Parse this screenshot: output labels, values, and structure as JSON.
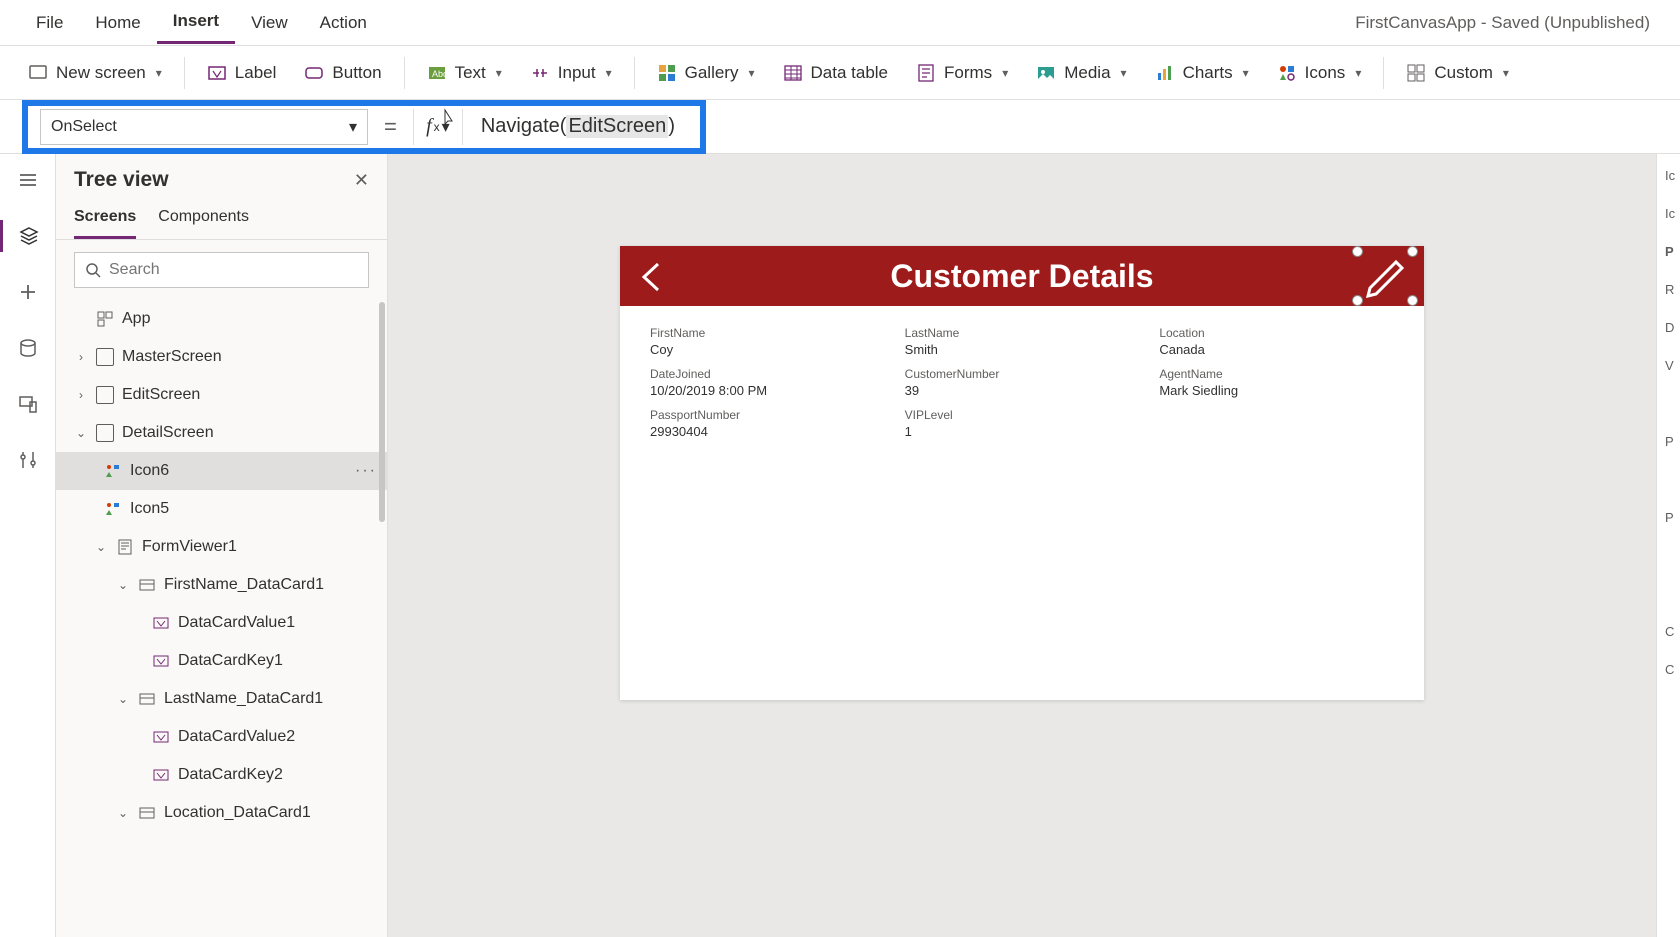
{
  "app_title": "FirstCanvasApp - Saved (Unpublished)",
  "menu": {
    "file": "File",
    "home": "Home",
    "insert": "Insert",
    "view": "View",
    "action": "Action"
  },
  "ribbon": {
    "new_screen": "New screen",
    "label": "Label",
    "button": "Button",
    "text": "Text",
    "input": "Input",
    "gallery": "Gallery",
    "data_table": "Data table",
    "forms": "Forms",
    "media": "Media",
    "charts": "Charts",
    "icons": "Icons",
    "custom": "Custom"
  },
  "formula": {
    "property": "OnSelect",
    "fn": "Navigate",
    "arg": "EditScreen"
  },
  "tree": {
    "title": "Tree view",
    "tabs": {
      "screens": "Screens",
      "components": "Components"
    },
    "search_placeholder": "Search",
    "nodes": {
      "app": "App",
      "master": "MasterScreen",
      "edit": "EditScreen",
      "detail": "DetailScreen",
      "icon6": "Icon6",
      "icon5": "Icon5",
      "formviewer": "FormViewer1",
      "firstname_dc": "FirstName_DataCard1",
      "dcv1": "DataCardValue1",
      "dck1": "DataCardKey1",
      "lastname_dc": "LastName_DataCard1",
      "dcv2": "DataCardValue2",
      "dck2": "DataCardKey2",
      "location_dc": "Location_DataCard1"
    }
  },
  "screen": {
    "title": "Customer Details",
    "cards": {
      "firstname": {
        "label": "FirstName",
        "value": "Coy"
      },
      "lastname": {
        "label": "LastName",
        "value": "Smith"
      },
      "location": {
        "label": "Location",
        "value": "Canada"
      },
      "datejoined": {
        "label": "DateJoined",
        "value": "10/20/2019 8:00 PM"
      },
      "custnum": {
        "label": "CustomerNumber",
        "value": "39"
      },
      "agent": {
        "label": "AgentName",
        "value": "Mark Siedling"
      },
      "passport": {
        "label": "PassportNumber",
        "value": "29930404"
      },
      "vip": {
        "label": "VIPLevel",
        "value": "1"
      }
    }
  },
  "right_panel": [
    "Ic",
    "Ic",
    "P",
    "R",
    "D",
    "V",
    "",
    "P",
    "",
    "P",
    "",
    "",
    "C",
    "C"
  ]
}
